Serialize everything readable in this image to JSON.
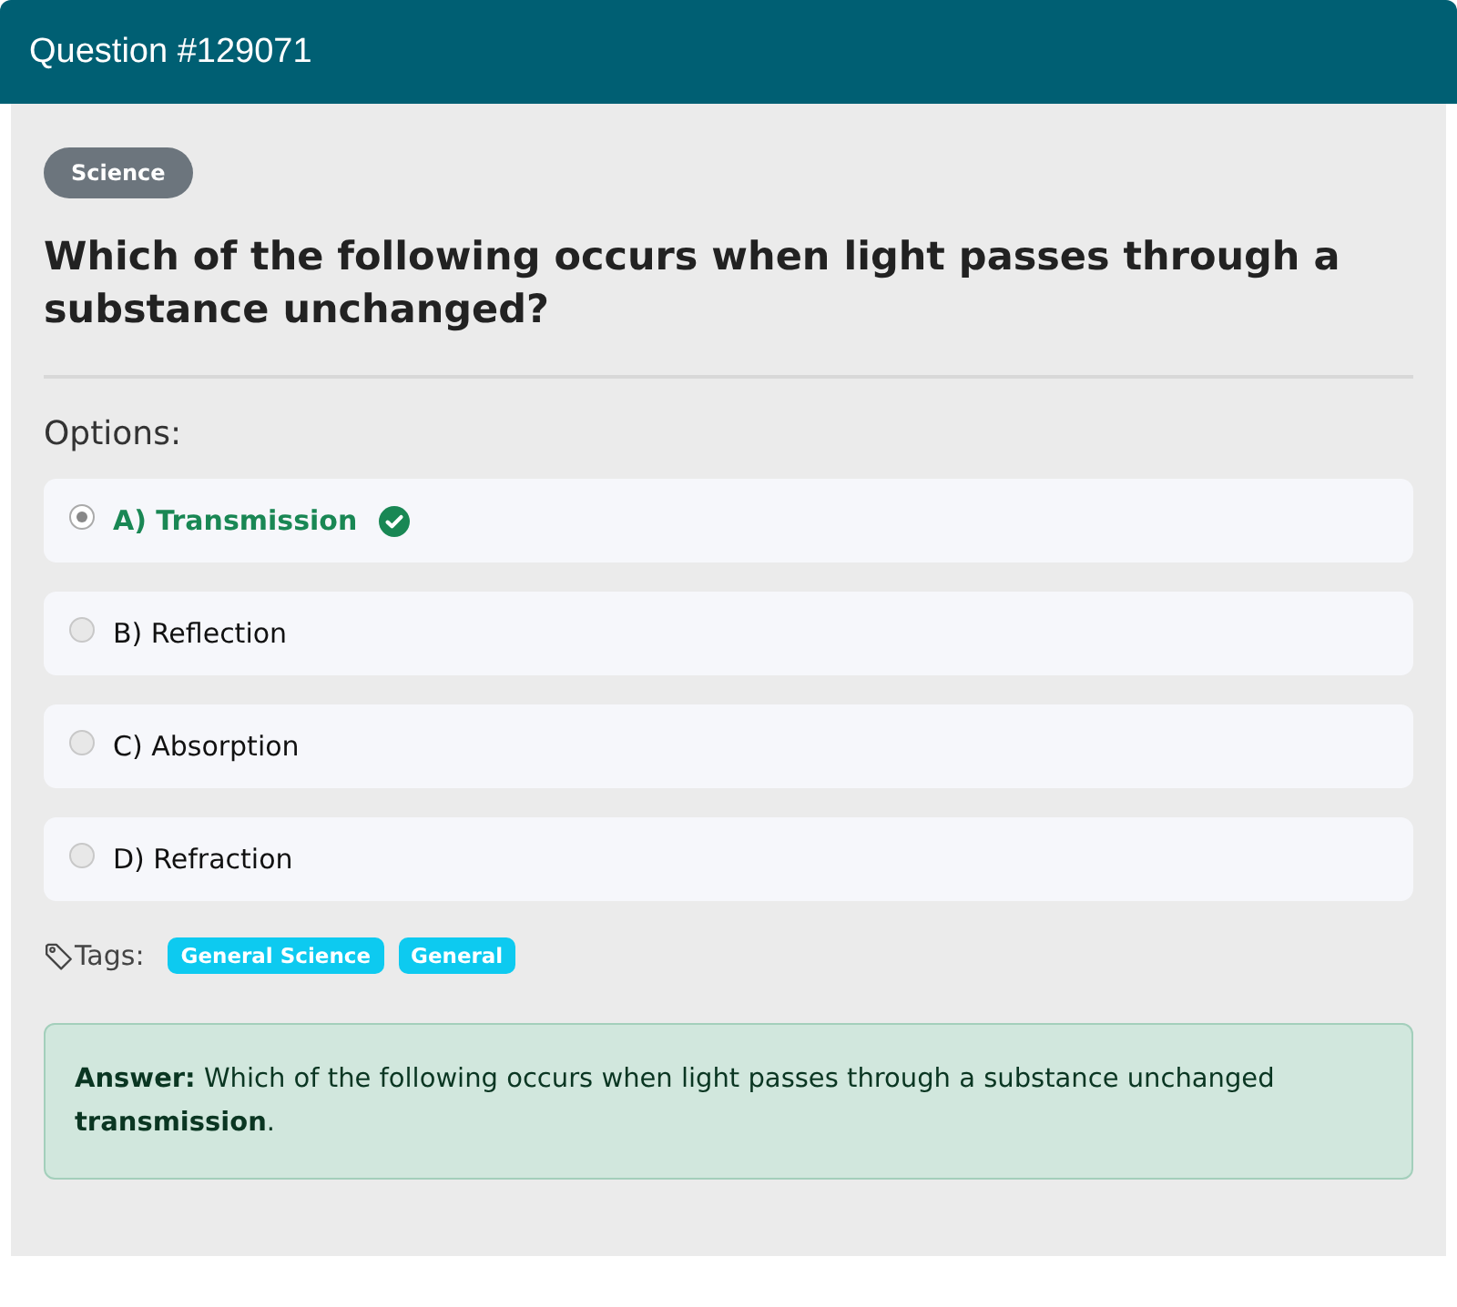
{
  "header": {
    "title": "Question #129071"
  },
  "category": "Science",
  "question": "Which of the following occurs when light passes through a substance unchanged?",
  "options_label": "Options:",
  "options": [
    {
      "label": "A) Transmission",
      "selected": true,
      "correct": true
    },
    {
      "label": "B) Reflection",
      "selected": false,
      "correct": false
    },
    {
      "label": "C) Absorption",
      "selected": false,
      "correct": false
    },
    {
      "label": "D) Refraction",
      "selected": false,
      "correct": false
    }
  ],
  "tags_label": "Tags:",
  "tags": [
    "General Science",
    "General"
  ],
  "answer": "**Answer:** Which of the following occurs when light passes through a substance unchanged **transmission**."
}
